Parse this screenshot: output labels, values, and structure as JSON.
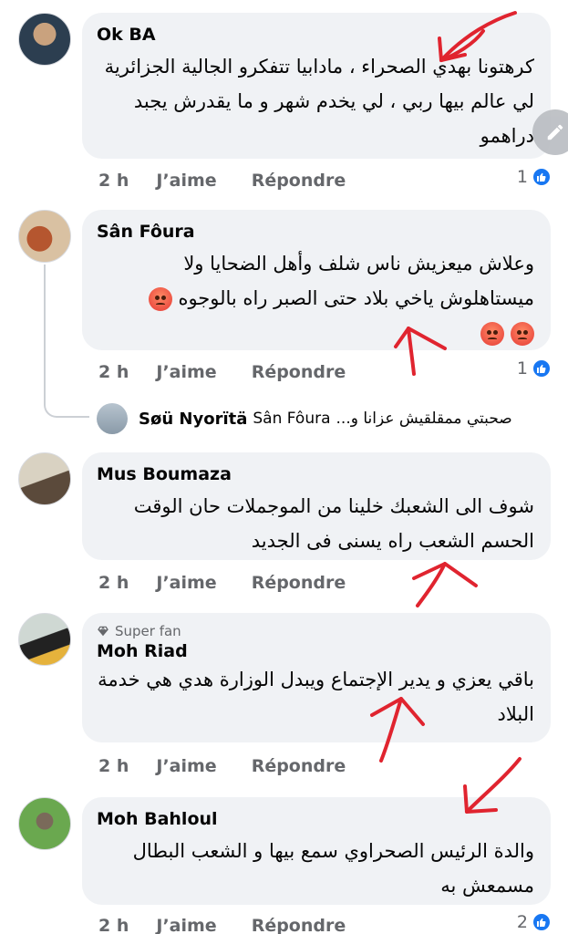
{
  "actions": {
    "like": "J’aime",
    "reply": "Répondre"
  },
  "comments": [
    {
      "author": "Ok BA",
      "text": "كرهتونا بهدي الصحراء ، مادابيا تتفكرو الجالية الجزائرية لي عالم بيها ربي ، لي يخدم شهر و ما يقدرش يجبد دراهمو",
      "time": "2 h",
      "reactions": "1"
    },
    {
      "author": "Sân Fôura",
      "text": "وعلاش ميعزيش ناس شلف وأهل الضحايا ولا ميستاهلوش ياخي بلاد حتى الصبر راه بالوجوه",
      "time": "2 h",
      "reactions": "1"
    },
    {
      "author": "Mus Boumaza",
      "text": "شوف الى الشعبك خلينا من الموجملات حان الوقت الحسم الشعب راه يسنى فى الجديد",
      "time": "2 h",
      "reactions": ""
    },
    {
      "author": "Moh Riad",
      "badge": "Super fan",
      "text": "باقي يعزي و يدير الإجتماع ويبدل الوزارة هدي هي خدمة البلاد",
      "time": "2 h",
      "reactions": ""
    },
    {
      "author": "Moh Bahloul",
      "text": "والدة الرئيس الصحراوي سمع بيها و الشعب البطال مسمعش به",
      "time": "2 h",
      "reactions": "2"
    }
  ],
  "reply": {
    "author": "Søü Nyorïtä",
    "tag": "Sân Fôura",
    "preview": "صحبتي ممقلقيش عزانا و..."
  },
  "colors": {
    "bubble": "#f0f2f5",
    "meta": "#65676b",
    "like_blue": "#1877f2",
    "annotation_red": "#e0242f"
  }
}
